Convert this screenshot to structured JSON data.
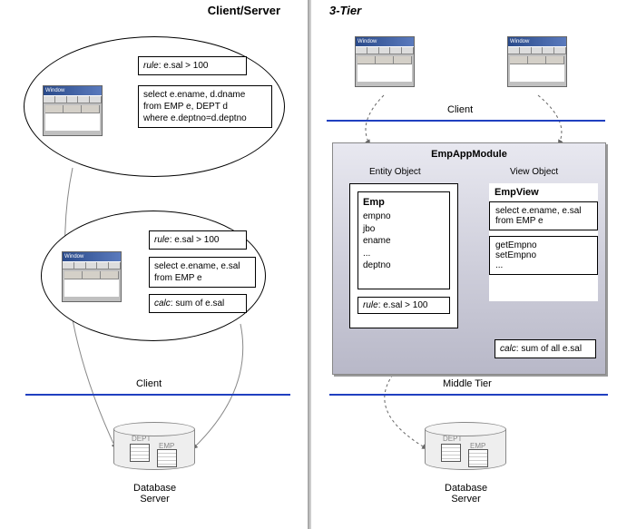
{
  "left": {
    "heading": "Client/Server",
    "rule1": "rule: e.sal > 100",
    "sql1_l1": "select e.ename, d.dname",
    "sql1_l2": "from EMP e, DEPT d",
    "sql1_l3": "where e.deptno=d.deptno",
    "rule2": "rule: e.sal > 100",
    "sql2_l1": "select e.ename, e.sal",
    "sql2_l2": "from EMP e",
    "calc2": "calc: sum of e.sal",
    "client_label": "Client",
    "db_label": "Database\nServer"
  },
  "right": {
    "heading": "3-Tier",
    "client_label": "Client",
    "module_title": "EmpAppModule",
    "entity_heading": "Entity Object",
    "view_heading": "View Object",
    "entity_name": "Emp",
    "entity_attrs": "empno\njbo\nename\n...\ndeptno",
    "entity_rule": "rule: e.sal > 100",
    "view_name": "EmpView",
    "view_sql": "select e.ename, e.sal\nfrom EMP e",
    "view_methods": "getEmpno\nsetEmpno\n...",
    "view_calc": "calc: sum of all e.sal",
    "middle_label": "Middle Tier",
    "db_label": "Database\nServer"
  },
  "win": {
    "title": "Window"
  },
  "db": {
    "table1": "DEPT",
    "table2": "EMP"
  }
}
